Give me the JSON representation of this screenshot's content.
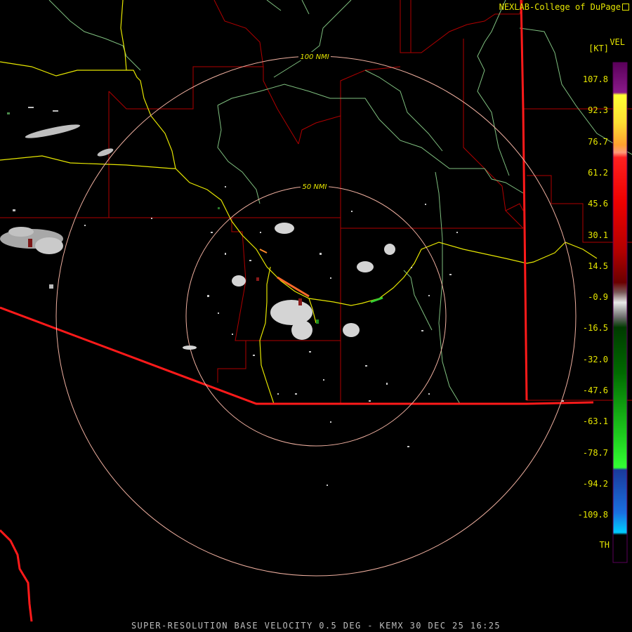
{
  "credit": "NEXLAB-College of DuPage",
  "legend": {
    "title": "VEL",
    "units": "[KT]",
    "labels": [
      "107.8",
      "92.3",
      "76.7",
      "61.2",
      "45.6",
      "30.1",
      "14.5",
      "-0.9",
      "-16.5",
      "-32.0",
      "-47.6",
      "-63.1",
      "-78.7",
      "-94.2",
      "-109.8",
      "TH"
    ]
  },
  "rings": {
    "inner": "50 NMI",
    "outer": "100 NMI"
  },
  "caption": "SUPER-RESOLUTION BASE VELOCITY 0.5 DEG - KEMX 30 DEC 25 16:25",
  "colors": {
    "state_border": "#ff1a1a",
    "county_line": "#b00000",
    "highway": "#e6e600",
    "river": "#7fbf7f",
    "range_ring": "#f0b0a0",
    "text": "#e6e600"
  }
}
